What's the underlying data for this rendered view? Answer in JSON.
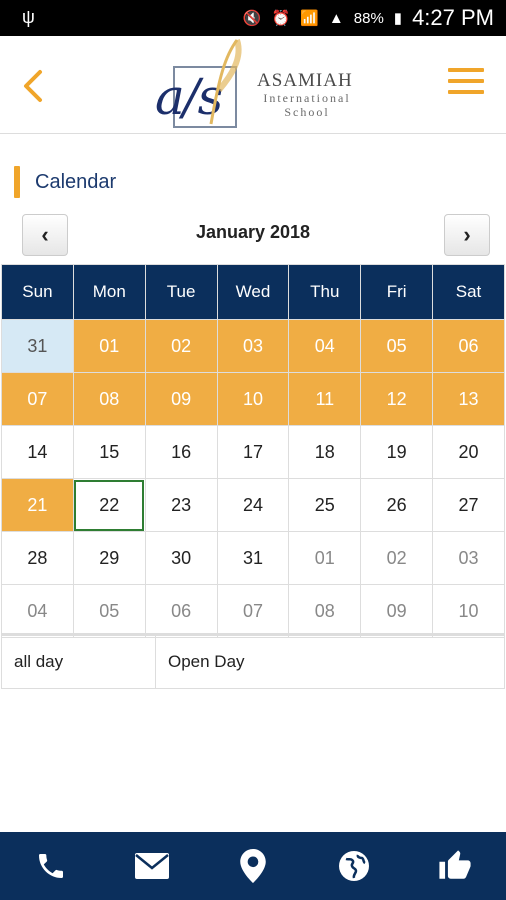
{
  "status_bar": {
    "battery": "88%",
    "time": "4:27 PM"
  },
  "header": {
    "logo_mark": "a/s",
    "school_name": "ASAMIAH",
    "school_sub": "International School"
  },
  "section": {
    "title": "Calendar"
  },
  "calendar": {
    "month": "January 2018",
    "prev_label": "‹",
    "next_label": "›",
    "weekdays": [
      "Sun",
      "Mon",
      "Tue",
      "Wed",
      "Thu",
      "Fri",
      "Sat"
    ],
    "weeks": [
      [
        "31",
        "01",
        "02",
        "03",
        "04",
        "05",
        "06"
      ],
      [
        "07",
        "08",
        "09",
        "10",
        "11",
        "12",
        "13"
      ],
      [
        "14",
        "15",
        "16",
        "17",
        "18",
        "19",
        "20"
      ],
      [
        "21",
        "22",
        "23",
        "24",
        "25",
        "26",
        "27"
      ],
      [
        "28",
        "29",
        "30",
        "31",
        "01",
        "02",
        "03"
      ],
      [
        "04",
        "05",
        "06",
        "07",
        "08",
        "09",
        "10"
      ]
    ]
  },
  "events": [
    {
      "time": "all day",
      "title": "Open Day"
    }
  ],
  "colors": {
    "accent": "#f0a52a",
    "navy": "#0b2f5c",
    "today_border": "#2e7d32",
    "prev_month": "#d6e9f5"
  },
  "bottom_nav": [
    "phone-icon",
    "mail-icon",
    "location-icon",
    "globe-icon",
    "thumbs-up-icon"
  ]
}
